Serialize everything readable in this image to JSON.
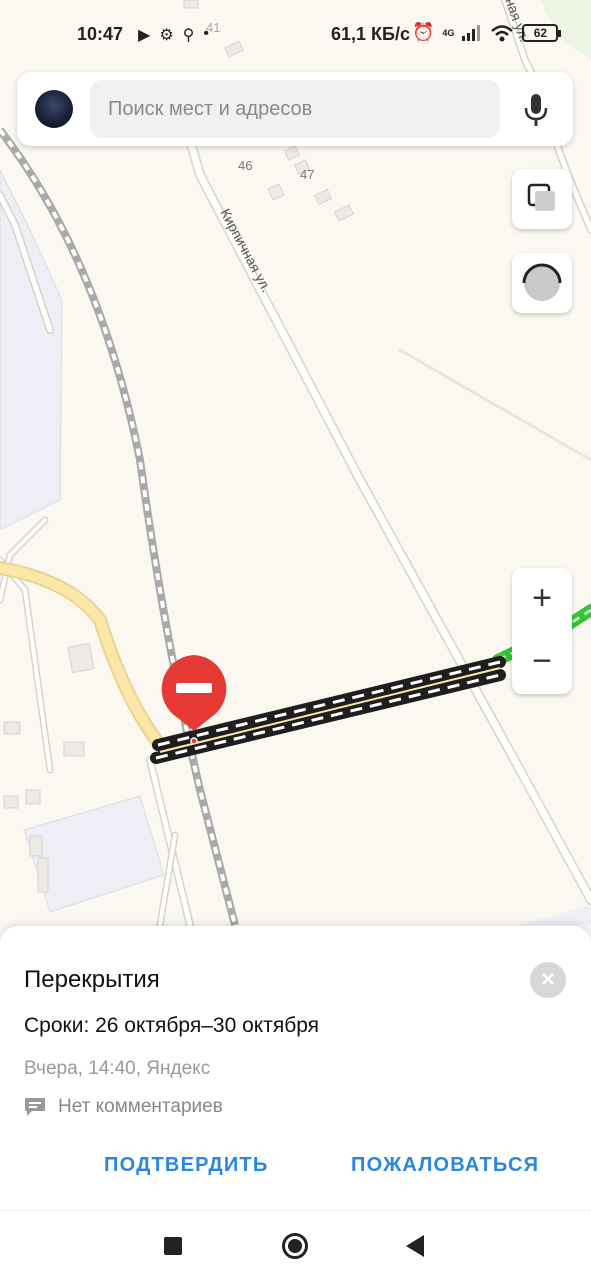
{
  "status_bar": {
    "time": "10:47",
    "net_speed": "61,1 КБ/с",
    "network_type": "4G",
    "battery": "62"
  },
  "search": {
    "placeholder": "Поиск мест и адресов"
  },
  "map": {
    "street_label": "Кирпичная ул.",
    "street_label_top": "ная ул.",
    "house_numbers": [
      "46",
      "47",
      "41"
    ],
    "zoom_in": "+",
    "zoom_out": "−",
    "colors": {
      "background": "#fbf8f2",
      "closure_red": "#e53935",
      "route_yellow": "#fbe7a8",
      "traffic_green": "#36c23a"
    }
  },
  "sheet": {
    "title": "Перекрытия",
    "dates": "Сроки: 26 октября–30 октября",
    "meta": "Вчера, 14:40, Яндекс",
    "comments": "Нет комментариев",
    "close": "×",
    "confirm": "ПОДТВЕРДИТЬ",
    "report": "ПОЖАЛОВАТЬСЯ"
  }
}
